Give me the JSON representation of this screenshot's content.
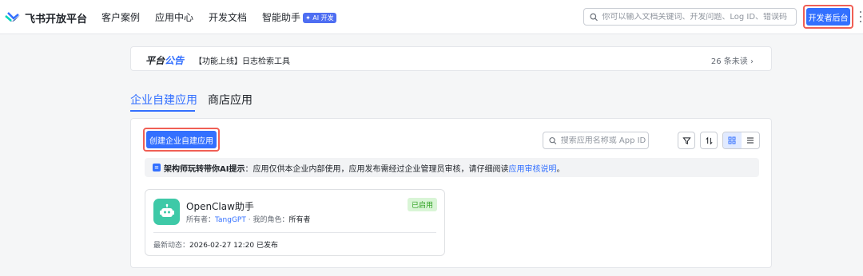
{
  "topbar": {
    "logo_text": "飞书开放平台",
    "nav": [
      "客户案例",
      "应用中心",
      "开发文档",
      "智能助手"
    ],
    "ai_badge": "✦ AI 开发",
    "search_placeholder": "你可以输入文档关键词、开发问题、Log ID、错误码",
    "dev_console_button": "开发者后台"
  },
  "notice": {
    "title_a": "平台",
    "title_b": "公告",
    "text": "【功能上线】日志检索工具",
    "unread": "26 条未读"
  },
  "tabs": {
    "active": "企业自建应用",
    "store": "商店应用"
  },
  "panel": {
    "create_button": "创建企业自建应用",
    "search_placeholder": "搜索应用名称或 App ID",
    "tip": {
      "prefix": "架构师玩转带你AI提示",
      "text": "：应用仅供本企业内部使用，应用发布需经过企业管理员审核，请仔细阅读 ",
      "link": "应用审核说明",
      "suffix": "。"
    }
  },
  "app_card": {
    "name": "OpenClaw助手",
    "status": "已启用",
    "owner_label": "所有者：",
    "owner": "TangGPT",
    "separator": " · ",
    "role_label": "我的角色：",
    "role": "所有者",
    "activity_label": "最新动态：",
    "activity": "2026-02-27 12:20 已发布"
  },
  "colors": {
    "primary": "#3370ff",
    "highlight_border": "#f05f55",
    "app_icon": "#3ec9a7",
    "status_bg": "#d9f5d6",
    "status_text": "#2ea121"
  }
}
